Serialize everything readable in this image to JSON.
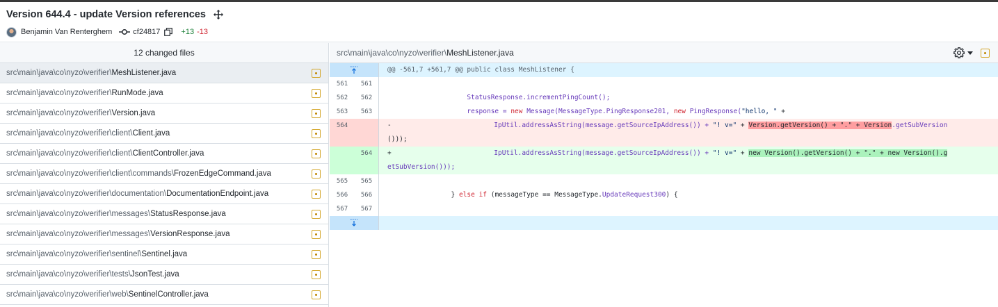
{
  "commit": {
    "title": "Version 644.4 - update Version references",
    "author": "Benjamin Van Renterghem",
    "sha": "cf24817",
    "additions": "+13",
    "deletions": "-13"
  },
  "files_panel": {
    "header": "12 changed files",
    "files": [
      {
        "dir": "src\\main\\java\\co\\nyzo\\verifier\\",
        "name": "MeshListener.java"
      },
      {
        "dir": "src\\main\\java\\co\\nyzo\\verifier\\",
        "name": "RunMode.java"
      },
      {
        "dir": "src\\main\\java\\co\\nyzo\\verifier\\",
        "name": "Version.java"
      },
      {
        "dir": "src\\main\\java\\co\\nyzo\\verifier\\client\\",
        "name": "Client.java"
      },
      {
        "dir": "src\\main\\java\\co\\nyzo\\verifier\\client\\",
        "name": "ClientController.java"
      },
      {
        "dir": "src\\main\\java\\co\\nyzo\\verifier\\client\\commands\\",
        "name": "FrozenEdgeCommand.java"
      },
      {
        "dir": "src\\main\\java\\co\\nyzo\\verifier\\documentation\\",
        "name": "DocumentationEndpoint.java"
      },
      {
        "dir": "src\\main\\java\\co\\nyzo\\verifier\\messages\\",
        "name": "StatusResponse.java"
      },
      {
        "dir": "src\\main\\java\\co\\nyzo\\verifier\\messages\\",
        "name": "VersionResponse.java"
      },
      {
        "dir": "src\\main\\java\\co\\nyzo\\verifier\\sentinel\\",
        "name": "Sentinel.java"
      },
      {
        "dir": "src\\main\\java\\co\\nyzo\\verifier\\tests\\",
        "name": "JsonTest.java"
      },
      {
        "dir": "src\\main\\java\\co\\nyzo\\verifier\\web\\",
        "name": "SentinelController.java"
      }
    ]
  },
  "diff": {
    "path_dir": "src\\main\\java\\co\\nyzo\\verifier\\",
    "path_name": "MeshListener.java",
    "hunk_header": "@@ -561,7 +561,7 @@ public class MeshListener {",
    "lines": {
      "l561": {
        "old": "561",
        "new": "561"
      },
      "l562": {
        "old": "562",
        "new": "562",
        "indent": "                    ",
        "a": "StatusResponse.incrementPingCount();"
      },
      "l563": {
        "old": "563",
        "new": "563",
        "indent": "                    ",
        "a": "response = ",
        "kw": "new",
        "b": " Message(MessageType.PingResponse201, ",
        "kw2": "new",
        "c": " PingResponse(",
        "s": "\"hello, \"",
        "d": " +"
      },
      "l564del": {
        "old": "564",
        "sign": "-",
        "indent": "                        ",
        "a": "IpUtil.addressAsString(message.getSourceIpAddress()) + ",
        "s1": "\"! v=\"",
        "b": " + ",
        "h": "Version.getVersion() + \".\" + Version",
        "c": ".getSubVersion",
        "wrap": "()));"
      },
      "l564add": {
        "new": "564",
        "sign": "+",
        "indent": "                        ",
        "a": "IpUtil.addressAsString(message.getSourceIpAddress()) + ",
        "s1": "\"! v=\"",
        "b": " + ",
        "h": "new Version().getVersion() + \".\" + new Version().g",
        "wrap": "etSubVersion()));"
      },
      "l565": {
        "old": "565",
        "new": "565"
      },
      "l566": {
        "old": "566",
        "new": "566",
        "indent": "                ",
        "a": "} ",
        "kw": "else if",
        "b": " (messageType == MessageType.",
        "i": "UpdateRequest300",
        "c": ") {"
      },
      "l567": {
        "old": "567",
        "new": "567"
      }
    }
  },
  "icons": {
    "move": "move-icon",
    "commit": "git-commit-icon",
    "copy": "copy-icon",
    "gear": "gear-icon",
    "modified": "file-modified-icon",
    "expand_up": "expand-up-icon",
    "expand_down": "expand-down-icon"
  },
  "colors": {
    "additions": "#1a7f37",
    "deletions": "#cf222e",
    "modified": "#bf8700",
    "hunk_bg": "#ddf4ff",
    "del_bg": "#ffebe9",
    "add_bg": "#e6ffec"
  }
}
